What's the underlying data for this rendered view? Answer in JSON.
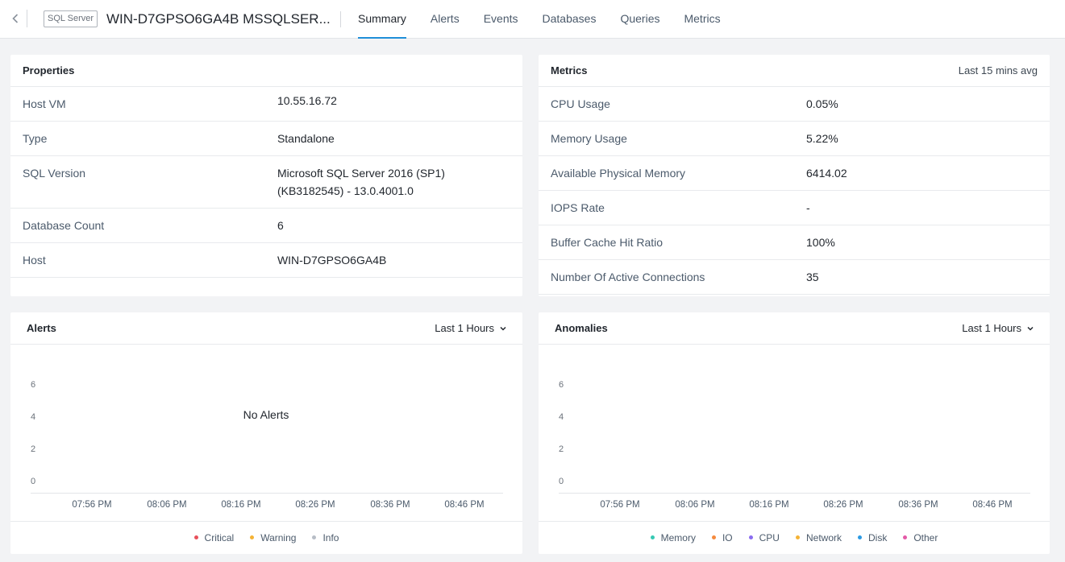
{
  "header": {
    "entity_tag": "SQL Server",
    "entity_name": "WIN-D7GPSO6GA4B MSSQLSER...",
    "tabs": [
      {
        "label": "Summary",
        "active": true
      },
      {
        "label": "Alerts",
        "active": false
      },
      {
        "label": "Events",
        "active": false
      },
      {
        "label": "Databases",
        "active": false
      },
      {
        "label": "Queries",
        "active": false
      },
      {
        "label": "Metrics",
        "active": false
      }
    ],
    "accent": "#1f8fd8"
  },
  "properties": {
    "title": "Properties",
    "rows": [
      {
        "key": "Host VM",
        "value": "10.55.16.72",
        "link": true
      },
      {
        "key": "Type",
        "value": "Standalone"
      },
      {
        "key": "SQL Version",
        "value": "Microsoft SQL Server 2016 (SP1) (KB3182545) - 13.0.4001.0"
      },
      {
        "key": "Database Count",
        "value": "6"
      },
      {
        "key": "Host",
        "value": "WIN-D7GPSO6GA4B"
      }
    ]
  },
  "metrics": {
    "title": "Metrics",
    "subtitle": "Last 15 mins avg",
    "rows": [
      {
        "key": "CPU Usage",
        "value": "0.05%"
      },
      {
        "key": "Memory Usage",
        "value": "5.22%"
      },
      {
        "key": "Available Physical Memory",
        "value": "6414.02"
      },
      {
        "key": "IOPS Rate",
        "value": "-"
      },
      {
        "key": "Buffer Cache Hit Ratio",
        "value": "100%"
      },
      {
        "key": "Number Of Active Connections",
        "value": "35"
      }
    ]
  },
  "alerts": {
    "title": "Alerts",
    "range": "Last 1 Hours",
    "empty_text": "No Alerts",
    "y_ticks": [
      "6",
      "4",
      "2",
      "0"
    ],
    "x_ticks": [
      "07:56 PM",
      "08:06 PM",
      "08:16 PM",
      "08:26 PM",
      "08:36 PM",
      "08:46 PM"
    ],
    "legend": [
      {
        "label": "Critical",
        "color": "#e8505b"
      },
      {
        "label": "Warning",
        "color": "#f5b335"
      },
      {
        "label": "Info",
        "color": "#b7bdc6"
      }
    ]
  },
  "anomalies": {
    "title": "Anomalies",
    "range": "Last 1 Hours",
    "y_ticks": [
      "6",
      "4",
      "2",
      "0"
    ],
    "x_ticks": [
      "07:56 PM",
      "08:06 PM",
      "08:16 PM",
      "08:26 PM",
      "08:36 PM",
      "08:46 PM"
    ],
    "legend": [
      {
        "label": "Memory",
        "color": "#36c9b3"
      },
      {
        "label": "IO",
        "color": "#f58a3d"
      },
      {
        "label": "CPU",
        "color": "#8a6cf0"
      },
      {
        "label": "Network",
        "color": "#f5b335"
      },
      {
        "label": "Disk",
        "color": "#2b9ae3"
      },
      {
        "label": "Other",
        "color": "#e45aa7"
      }
    ]
  }
}
